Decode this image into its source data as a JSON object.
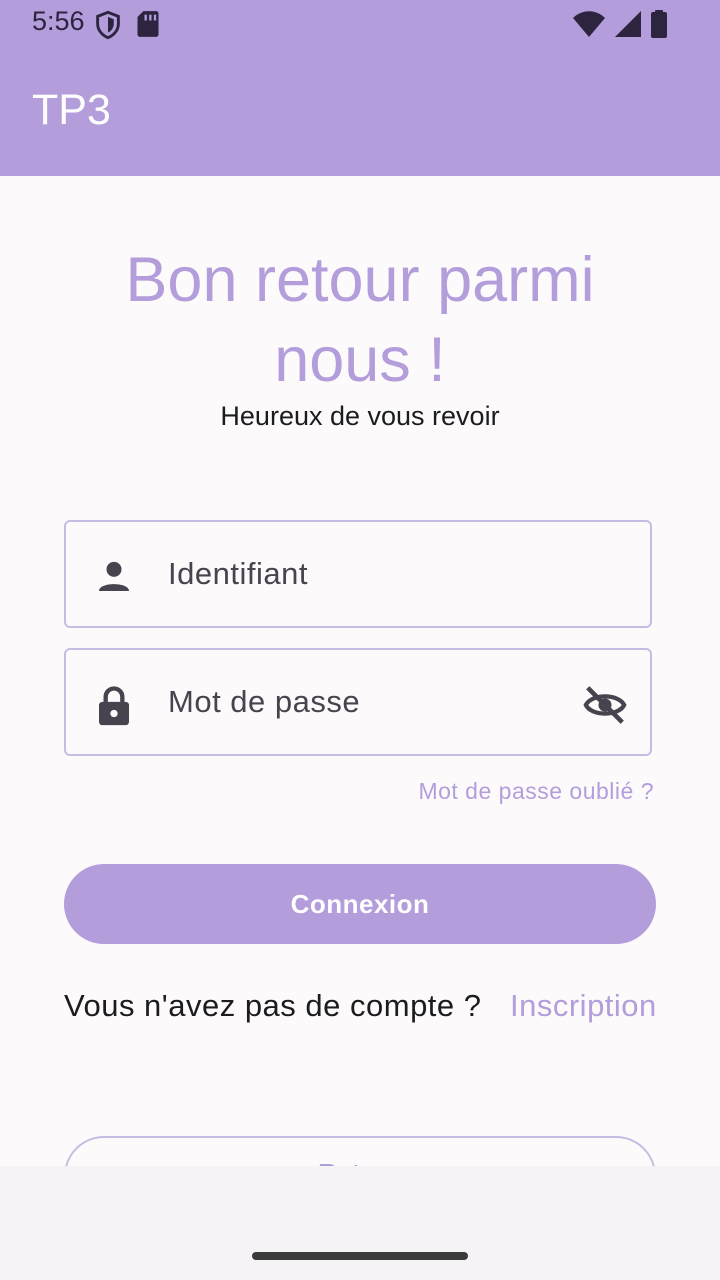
{
  "status_bar": {
    "time": "5:56",
    "icons": [
      "shield-icon",
      "sd-card-icon",
      "wifi-icon",
      "cell-signal-icon",
      "battery-icon"
    ]
  },
  "app_bar": {
    "title": "TP3"
  },
  "login": {
    "title": "Bon retour parmi nous !",
    "subtitle": "Heureux de vous revoir",
    "username_placeholder": "Identifiant",
    "password_placeholder": "Mot de passe",
    "forgot_password": "Mot de passe oublié ?",
    "login_button": "Connexion",
    "no_account_text": "Vous n'avez pas de compte ?",
    "signup_link": "Inscription",
    "secondary_button": "Retour"
  },
  "colors": {
    "accent": "#b39ddb",
    "background": "#fcfafa",
    "text": "#1c1b1f",
    "field_border": "#c7bce3"
  }
}
